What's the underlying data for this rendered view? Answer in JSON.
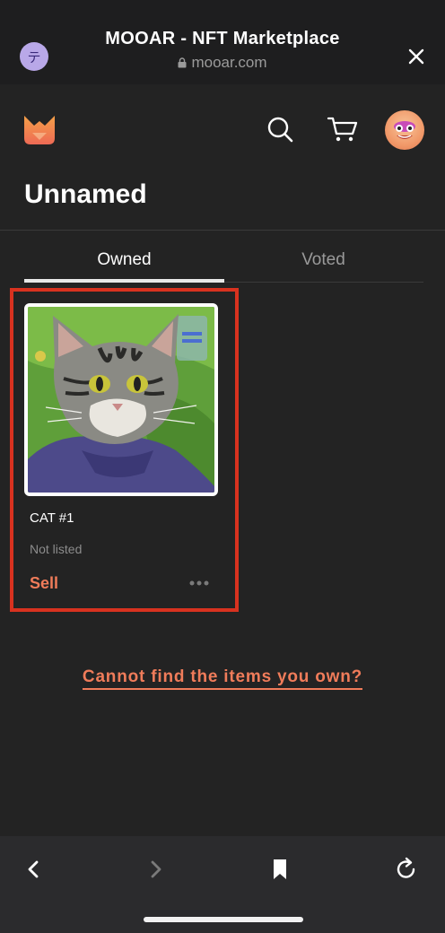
{
  "browser": {
    "site_icon_glyph": "テ",
    "title": "MOOAR - NFT Marketplace",
    "url": "mooar.com"
  },
  "header": {
    "logo_icon": "mooar-logo-icon",
    "search_icon": "search-icon",
    "cart_icon": "cart-icon",
    "avatar": "avatar"
  },
  "page": {
    "title": "Unnamed"
  },
  "tabs": [
    {
      "label": "Owned",
      "active": true
    },
    {
      "label": "Voted",
      "active": false
    }
  ],
  "items": [
    {
      "name": "CAT #1",
      "status": "Not listed",
      "action_label": "Sell"
    }
  ],
  "help_link": "Cannot find the items you own?",
  "colors": {
    "accent": "#f07c5a",
    "highlight": "#d8321f",
    "background": "#232323"
  }
}
